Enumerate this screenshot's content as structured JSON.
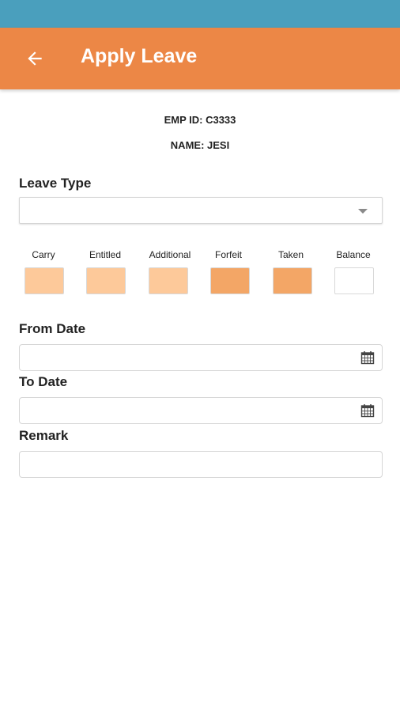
{
  "header": {
    "title": "Apply Leave",
    "back_icon": "arrow-left-icon",
    "color": "#ec8746",
    "status_bar_color": "#4a9fbd"
  },
  "employee": {
    "emp_id": "EMP ID: C3333",
    "name": "NAME: JESI"
  },
  "leave_type": {
    "label": "Leave Type",
    "selected": ""
  },
  "balances": [
    {
      "label": "Carry",
      "color": "#fdc99a"
    },
    {
      "label": "Entitled",
      "color": "#fdc99a"
    },
    {
      "label": "Additional",
      "color": "#fdc99a"
    },
    {
      "label": "Forfeit",
      "color": "#f3a666"
    },
    {
      "label": "Taken",
      "color": "#f3a666"
    },
    {
      "label": "Balance",
      "color": "#ffffff"
    }
  ],
  "from_date": {
    "label": "From Date",
    "value": "",
    "icon": "calendar-icon"
  },
  "to_date": {
    "label": "To Date",
    "value": "",
    "icon": "calendar-icon"
  },
  "remark": {
    "label": "Remark",
    "value": ""
  }
}
